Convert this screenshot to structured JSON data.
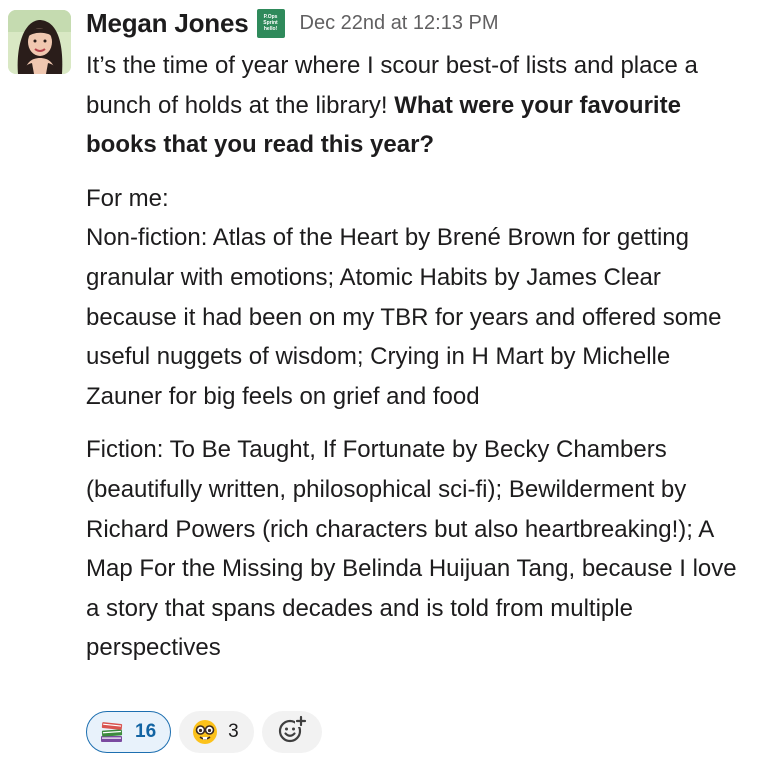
{
  "message": {
    "author": "Megan Jones",
    "status_badge": {
      "line1": "P.Ops",
      "line2": "Sprint",
      "line3": "hello!"
    },
    "timestamp": "Dec 22nd at 12:13 PM",
    "para1_plain": "It’s the time of year where I scour best-of lists and place a bunch of holds at the library! ",
    "para1_bold": "What were your favourite books that you read this year?",
    "para2_intro": "For me:",
    "para2_body": "Non-fiction: Atlas of the Heart by Brené Brown for getting granular with emotions; Atomic Habits by James Clear because it had been on my TBR for years and offered some useful nuggets of wisdom; Crying in H Mart by Michelle Zauner for big feels on grief and food",
    "para3": "Fiction: To Be Taught, If Fortunate by Becky Chambers (beautifully written, philosophical sci-fi); Bewilderment by Richard Powers (rich characters but also heartbreaking!); A Map For the Missing by Belinda Huijuan Tang, because I love a story that spans decades and is told from multiple perspectives"
  },
  "reactions": [
    {
      "icon": "books-emoji-icon",
      "count": "16",
      "active": true
    },
    {
      "icon": "nerd-face-emoji-icon",
      "count": "3",
      "active": false
    }
  ],
  "add_reaction_icon": "add-reaction-icon",
  "colors": {
    "text": "#1d1c1d",
    "timestamp": "#616061",
    "active_reaction_border": "#1d6fb0",
    "active_reaction_bg": "#e8f2fb",
    "badge": "#2f8a5b"
  }
}
